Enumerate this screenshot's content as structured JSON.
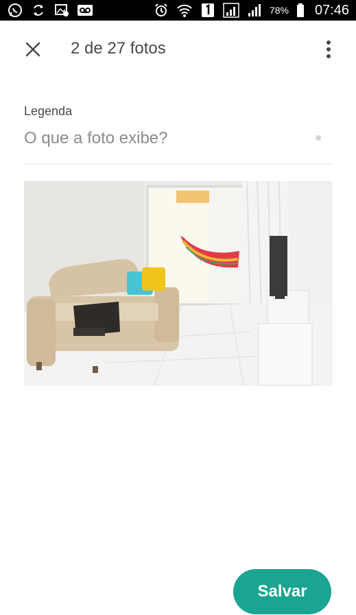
{
  "status_bar": {
    "left_icons": [
      "whatsapp-icon",
      "sync-icon",
      "image-notification-icon",
      "voicemail-icon"
    ],
    "right_icons": [
      "alarm-icon",
      "wifi-icon",
      "sim-1-icon",
      "signal-icon",
      "signal-icon",
      "battery-icon"
    ],
    "battery": "78%",
    "time": "07:46"
  },
  "app_bar": {
    "title": "2 de 27 fotos",
    "close_icon": "close-icon",
    "menu_icon": "more-vertical-icon"
  },
  "caption": {
    "label": "Legenda",
    "placeholder": "O que a foto exibe?",
    "value": ""
  },
  "photo": {
    "subject": "living room with beige sofa, hammock on balcony and TV"
  },
  "actions": {
    "save_label": "Salvar"
  },
  "colors": {
    "accent": "#1aa592",
    "text": "#484848",
    "placeholder": "#8a8a8a",
    "status_bar": "#000000"
  }
}
